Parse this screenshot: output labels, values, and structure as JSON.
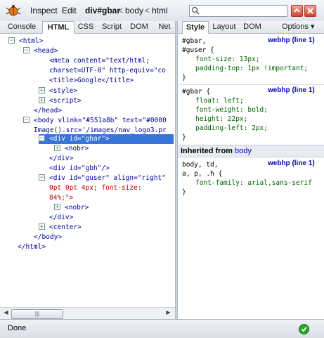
{
  "toolbar": {
    "inspect": "Inspect",
    "edit": "Edit",
    "crumb_selected": "div#gbar",
    "crumb_sep": "<",
    "crumb_body": "body",
    "crumb_html": "html",
    "search_value": ""
  },
  "left_tabs": [
    "Console",
    "HTML",
    "CSS",
    "Script",
    "DOM",
    "Net"
  ],
  "right_tabs": [
    "Style",
    "Layout",
    "DOM"
  ],
  "options_label": "Options",
  "options_arrow": "▾",
  "tree": [
    {
      "t": "<html>"
    },
    {
      "t": "<head>"
    },
    {
      "a": "<meta content=\"text/html;"
    },
    {
      "a": "charset=UTF-8\" http-equiv=\"co"
    },
    {
      "a": "<title>Google</title>"
    },
    {
      "t": "<style>"
    },
    {
      "t": "<script>"
    },
    {
      "t": "</head>"
    },
    {
      "a": "<body vlink=\"#551a8b\" text=\"#0000"
    },
    {
      "a": "Image().src='/images/nav_logo3.pr"
    },
    {
      "t": "<div id=\"gbar\">"
    },
    {
      "t": "<nobr>"
    },
    {
      "t": "</div>"
    },
    {
      "t": "<div id=\"gbh\"/>"
    },
    {
      "a": "<div id=\"guser\" align=\"right\""
    },
    {
      "a": "0pt 0pt 4px; font-size:"
    },
    {
      "a": "84%;\">"
    },
    {
      "t": "<nobr>"
    },
    {
      "t": "</div>"
    },
    {
      "t": "<center>"
    },
    {
      "t": "</body>"
    },
    {
      "t": "</html>"
    }
  ],
  "tree_signs": {
    "minus": "−",
    "plus": "+"
  },
  "style_rules": [
    {
      "selector_lines": [
        "#gbar,",
        "#guser {"
      ],
      "source": "webhp (line 1)",
      "props": [
        "font-size: 13px;",
        "padding-top: 1px !important;"
      ],
      "close": "}"
    },
    {
      "selector_lines": [
        "#gbar {"
      ],
      "source": "webhp (line 1)",
      "props": [
        "float: left;",
        "font-weight: bold;",
        "height: 22px;",
        "padding-left: 2px;"
      ],
      "close": "}"
    }
  ],
  "inherited": {
    "label": "Inherited from",
    "from": "body"
  },
  "inherited_rule": {
    "selector_lines": [
      "body, td,",
      "a, p, .h {"
    ],
    "source": "webhp (line 1)",
    "props": [
      "font-family: arial,sans-serif"
    ],
    "close": "}"
  },
  "status": {
    "text": "Done"
  },
  "colors": {
    "tag": "#0000a0",
    "value": "#c00000",
    "selection": "#3875d7",
    "accent_red": "#d4402c",
    "status_ok": "#2aa52a"
  },
  "icons": [
    "firebug-icon",
    "search-icon",
    "minimize-up-icon",
    "close-icon",
    "status-ok-icon"
  ]
}
